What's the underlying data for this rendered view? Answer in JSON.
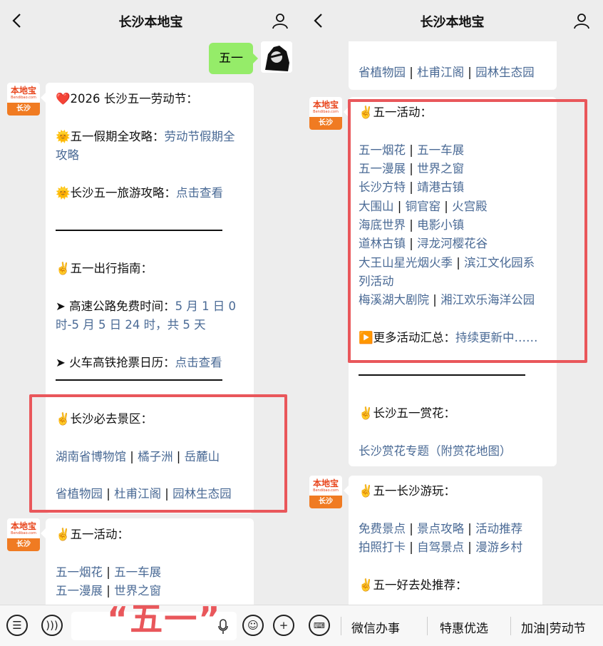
{
  "app": {
    "title": "长沙本地宝"
  },
  "left": {
    "sent_message": "五一",
    "bubble1": {
      "heading": "❤️2026 长沙五一劳动节：",
      "line1_prefix": "🌞五一假期全攻略：",
      "line1_link": "劳动节假期全",
      "line1_link2": "攻略",
      "line2_prefix": "🌞长沙五一旅游攻略：",
      "line2_link": "点击查看",
      "travel_heading": "✌️五一出行指南：",
      "highway_prefix": "➤ 高速公路免费时间：",
      "highway_link": "5 月 1 日 0",
      "highway_link2": "时-5 月 5 日 24 时，共 5 天",
      "train_prefix": "➤ 火车高铁抢票日历：",
      "train_link": "点击查看",
      "scenic_heading": "✌️长沙必去景区：",
      "scenic1": [
        "湖南省博物馆",
        "橘子洲",
        "岳麓山"
      ],
      "scenic2": [
        "省植物园",
        "杜甫江阁",
        "园林生态园"
      ]
    },
    "bubble2": {
      "heading": "✌️五一活动：",
      "row1": [
        "五一烟花",
        "五一车展"
      ],
      "row2": [
        "五一漫展",
        "世界之窗"
      ]
    }
  },
  "right": {
    "top_partial": [
      "省植物园",
      "杜甫江阁",
      "园林生态园"
    ],
    "activities": {
      "heading": "✌️五一活动：",
      "rows": [
        [
          "五一烟花",
          "五一车展"
        ],
        [
          "五一漫展",
          "世界之窗"
        ],
        [
          "长沙方特",
          "靖港古镇"
        ],
        [
          "大围山",
          "铜官窑",
          "火宫殿"
        ],
        [
          "海底世界",
          "电影小镇"
        ],
        [
          "道林古镇",
          "浔龙河樱花谷"
        ],
        [
          "大王山星光烟火季",
          "滨江文化园系"
        ]
      ],
      "row7_cont": "列活动",
      "row8": [
        "梅溪湖大剧院",
        "湘江欢乐海洋公园"
      ],
      "more_prefix": "▶️更多活动汇总：",
      "more_link": "持续更新中……"
    },
    "flowers_heading": "✌️长沙五一赏花：",
    "flowers_link": "长沙赏花专题（附赏花地图）",
    "bubble3": {
      "heading": "✌️五一长沙游玩：",
      "row1": [
        "免费景点",
        "景点攻略",
        "活动推荐"
      ],
      "row2": [
        "拍照打卡",
        "自驾景点",
        "漫游乡村"
      ],
      "heading2": "✌️五一好去处推荐："
    }
  },
  "avatar": {
    "brand": "本地宝",
    "site": "Bendibao.com",
    "city": "长沙"
  },
  "bottom_menu": [
    "微信办事",
    "特惠优选",
    "加油|劳动节"
  ],
  "overlay_caption": "“五一”",
  "colors": {
    "link": "#4a6a95",
    "highlight_box": "#e9575b",
    "sent_bubble": "#95ec69"
  }
}
